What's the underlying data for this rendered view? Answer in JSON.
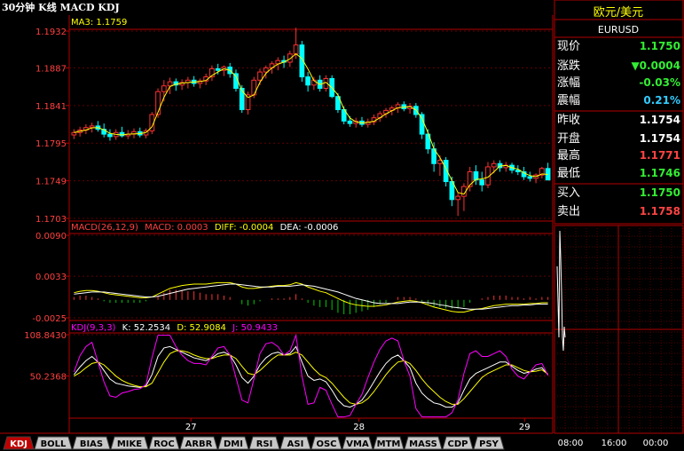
{
  "header": {
    "title": "30分钟 K线 MACD KDJ"
  },
  "price_panel": {
    "ma_label": "MA3: 1.1759",
    "yticks": [
      {
        "label": "1.1932",
        "v": 1.1932
      },
      {
        "label": "1.1887",
        "v": 1.1887
      },
      {
        "label": "1.1841",
        "v": 1.1841
      },
      {
        "label": "1.1795",
        "v": 1.1795
      },
      {
        "label": "1.1749",
        "v": 1.1749
      },
      {
        "label": "1.1703",
        "v": 1.1703
      }
    ],
    "ylim": [
      1.1703,
      1.1932
    ]
  },
  "macd_panel": {
    "label_title": "MACD(26,12,9)",
    "label_macd": "MACD: 0.0003",
    "label_diff": "DIFF: -0.0004",
    "label_dea": "DEA: -0.0006",
    "yticks": [
      {
        "label": "0.0090",
        "v": 0.009
      },
      {
        "label": "0.0033",
        "v": 0.0033
      },
      {
        "label": "-0.0025",
        "v": -0.0025
      }
    ],
    "ylim": [
      -0.0025,
      0.009
    ]
  },
  "kdj_panel": {
    "label_title": "KDJ(9,3,3)",
    "label_k": "K: 52.2534",
    "label_d": "D: 52.9084",
    "label_j": "J: 50.9433",
    "yticks": [
      {
        "label": "108.8430",
        "v": 108.843
      },
      {
        "label": "50.2368",
        "v": 50.2368
      }
    ],
    "ylim": [
      -8.4,
      108.843
    ]
  },
  "xaxis": {
    "labels": [
      {
        "label": "27",
        "pos": 0.25
      },
      {
        "label": "28",
        "pos": 0.6
      },
      {
        "label": "29",
        "pos": 0.945
      }
    ]
  },
  "tabs": [
    "KDJ",
    "BOLL",
    "BIAS",
    "MIKE",
    "ROC",
    "ARBR",
    "DMI",
    "RSI",
    "ASI",
    "OSC",
    "VMA",
    "MTM",
    "MASS",
    "CDP",
    "PSY"
  ],
  "active_tab": "KDJ",
  "quote": {
    "name": "欧元/美元",
    "symbol": "EURUSD",
    "rows": [
      {
        "label": "现价",
        "value": "1.1750",
        "color": "#33ee33"
      },
      {
        "label": "涨跌",
        "value": "▼0.0004",
        "color": "#33ee33"
      },
      {
        "label": "涨幅",
        "value": "-0.03%",
        "color": "#33ee33"
      },
      {
        "label": "震幅",
        "value": "0.21%",
        "color": "#33ccff"
      },
      {
        "label": "昨收",
        "value": "1.1754",
        "color": "#ffffff"
      },
      {
        "label": "开盘",
        "value": "1.1754",
        "color": "#ffffff"
      },
      {
        "label": "最高",
        "value": "1.1771",
        "color": "#ff4444"
      },
      {
        "label": "最低",
        "value": "1.1746",
        "color": "#33ee33"
      },
      {
        "label": "买入",
        "value": "1.1750",
        "color": "#33ee33"
      },
      {
        "label": "卖出",
        "value": "1.1758",
        "color": "#ff4444"
      }
    ]
  },
  "intraday": {
    "time_labels": [
      "08:00",
      "16:00",
      "00:00"
    ]
  },
  "colors": {
    "up": "#ff3030",
    "down": "#00ffff",
    "frame": "#b40000",
    "axis_text": "#ff4040",
    "ma": "#ffff00",
    "k": "#ffffff",
    "d": "#ffff00",
    "j": "#ff00ff"
  },
  "chart_data": [
    {
      "type": "candlestick",
      "title": "MA3: 1.1759",
      "ylim": [
        1.1703,
        1.1932
      ],
      "ohlc": [
        [
          1.1805,
          1.1812,
          1.18,
          1.1808
        ],
        [
          1.1808,
          1.1815,
          1.1803,
          1.1811
        ],
        [
          1.1811,
          1.1818,
          1.1806,
          1.1814
        ],
        [
          1.1814,
          1.182,
          1.1808,
          1.1816
        ],
        [
          1.1816,
          1.1822,
          1.1809,
          1.1812
        ],
        [
          1.1812,
          1.1819,
          1.1802,
          1.1806
        ],
        [
          1.1806,
          1.1812,
          1.1798,
          1.1803
        ],
        [
          1.1803,
          1.1812,
          1.1799,
          1.1808
        ],
        [
          1.1808,
          1.1815,
          1.1802,
          1.1804
        ],
        [
          1.1804,
          1.1811,
          1.18,
          1.1806
        ],
        [
          1.1806,
          1.1813,
          1.1801,
          1.1809
        ],
        [
          1.1809,
          1.1814,
          1.1802,
          1.1805
        ],
        [
          1.1805,
          1.1813,
          1.1801,
          1.181
        ],
        [
          1.181,
          1.1833,
          1.1806,
          1.183
        ],
        [
          1.183,
          1.1862,
          1.1826,
          1.1858
        ],
        [
          1.1858,
          1.1872,
          1.1846,
          1.1865
        ],
        [
          1.1865,
          1.1875,
          1.1855,
          1.187
        ],
        [
          1.187,
          1.1874,
          1.1859,
          1.1866
        ],
        [
          1.1866,
          1.1873,
          1.186,
          1.1869
        ],
        [
          1.1869,
          1.1876,
          1.1862,
          1.1872
        ],
        [
          1.1872,
          1.1877,
          1.1864,
          1.1868
        ],
        [
          1.1868,
          1.1874,
          1.1862,
          1.1871
        ],
        [
          1.1871,
          1.188,
          1.1866,
          1.1876
        ],
        [
          1.1876,
          1.189,
          1.1871,
          1.1886
        ],
        [
          1.1886,
          1.1892,
          1.1879,
          1.1884
        ],
        [
          1.1884,
          1.189,
          1.1877,
          1.1888
        ],
        [
          1.1888,
          1.1893,
          1.1875,
          1.188
        ],
        [
          1.188,
          1.1885,
          1.1858,
          1.1862
        ],
        [
          1.1862,
          1.1866,
          1.1832,
          1.1836
        ],
        [
          1.1836,
          1.1858,
          1.183,
          1.1854
        ],
        [
          1.1854,
          1.1876,
          1.185,
          1.1872
        ],
        [
          1.1872,
          1.1886,
          1.1866,
          1.1882
        ],
        [
          1.1882,
          1.189,
          1.1874,
          1.1887
        ],
        [
          1.1887,
          1.1895,
          1.188,
          1.1892
        ],
        [
          1.1892,
          1.19,
          1.1884,
          1.1896
        ],
        [
          1.1896,
          1.1902,
          1.1887,
          1.1894
        ],
        [
          1.1894,
          1.1908,
          1.1888,
          1.1904
        ],
        [
          1.1904,
          1.1936,
          1.1898,
          1.1915
        ],
        [
          1.1915,
          1.192,
          1.187,
          1.1876
        ],
        [
          1.1876,
          1.1882,
          1.1858,
          1.1866
        ],
        [
          1.1866,
          1.1876,
          1.186,
          1.1872
        ],
        [
          1.1872,
          1.1878,
          1.1858,
          1.1862
        ],
        [
          1.1862,
          1.1878,
          1.1858,
          1.1874
        ],
        [
          1.1874,
          1.1878,
          1.185,
          1.1852
        ],
        [
          1.1852,
          1.1856,
          1.1832,
          1.1836
        ],
        [
          1.1836,
          1.184,
          1.1818,
          1.1822
        ],
        [
          1.1822,
          1.1828,
          1.1815,
          1.1819
        ],
        [
          1.1819,
          1.1826,
          1.1814,
          1.1822
        ],
        [
          1.1822,
          1.1827,
          1.1815,
          1.1818
        ],
        [
          1.1818,
          1.1825,
          1.1814,
          1.1821
        ],
        [
          1.1821,
          1.183,
          1.1817,
          1.1826
        ],
        [
          1.1826,
          1.1834,
          1.1821,
          1.1831
        ],
        [
          1.1831,
          1.1838,
          1.1826,
          1.1835
        ],
        [
          1.1835,
          1.1841,
          1.1829,
          1.1838
        ],
        [
          1.1838,
          1.1845,
          1.1832,
          1.1842
        ],
        [
          1.1842,
          1.1846,
          1.1834,
          1.1837
        ],
        [
          1.1837,
          1.1844,
          1.1831,
          1.184
        ],
        [
          1.184,
          1.1844,
          1.1826,
          1.183
        ],
        [
          1.183,
          1.1833,
          1.18,
          1.1806
        ],
        [
          1.1806,
          1.1812,
          1.1782,
          1.1788
        ],
        [
          1.1788,
          1.1796,
          1.176,
          1.177
        ],
        [
          1.177,
          1.178,
          1.1755,
          1.1774
        ],
        [
          1.1774,
          1.1778,
          1.1742,
          1.1748
        ],
        [
          1.1748,
          1.1754,
          1.1718,
          1.1726
        ],
        [
          1.1726,
          1.1735,
          1.1706,
          1.173
        ],
        [
          1.173,
          1.1746,
          1.1712,
          1.1742
        ],
        [
          1.1742,
          1.1766,
          1.1736,
          1.176
        ],
        [
          1.176,
          1.1768,
          1.1744,
          1.175
        ],
        [
          1.175,
          1.176,
          1.1736,
          1.1744
        ],
        [
          1.1744,
          1.1772,
          1.174,
          1.1766
        ],
        [
          1.1766,
          1.1774,
          1.1758,
          1.177
        ],
        [
          1.177,
          1.1774,
          1.176,
          1.1765
        ],
        [
          1.1765,
          1.1772,
          1.176,
          1.1768
        ],
        [
          1.1768,
          1.1771,
          1.1758,
          1.1762
        ],
        [
          1.1762,
          1.1768,
          1.1756,
          1.176
        ],
        [
          1.176,
          1.1766,
          1.175,
          1.1754
        ],
        [
          1.1754,
          1.176,
          1.1748,
          1.1752
        ],
        [
          1.1752,
          1.1758,
          1.1746,
          1.1756
        ],
        [
          1.1756,
          1.1766,
          1.1752,
          1.1764
        ],
        [
          1.1764,
          1.1771,
          1.1752,
          1.175
        ]
      ]
    },
    {
      "type": "line",
      "title": "MACD(26,12,9)",
      "ylim": [
        -0.0025,
        0.009
      ],
      "series": [
        {
          "name": "DIFF",
          "values": [
            0.001,
            0.0012,
            0.0013,
            0.0013,
            0.0012,
            0.001,
            0.0008,
            0.0007,
            0.0006,
            0.0005,
            0.0004,
            0.0003,
            0.0003,
            0.0004,
            0.0008,
            0.0012,
            0.0016,
            0.0018,
            0.002,
            0.0021,
            0.0022,
            0.0022,
            0.0022,
            0.0023,
            0.0024,
            0.0024,
            0.0024,
            0.0022,
            0.0018,
            0.0016,
            0.0016,
            0.0017,
            0.0018,
            0.0019,
            0.002,
            0.002,
            0.0021,
            0.0024,
            0.0022,
            0.0018,
            0.0015,
            0.0012,
            0.001,
            0.0006,
            0.0002,
            -0.0002,
            -0.0005,
            -0.0007,
            -0.0008,
            -0.0009,
            -0.0009,
            -0.0008,
            -0.0007,
            -0.0005,
            -0.0003,
            -0.0002,
            -0.0001,
            -0.0002,
            -0.0004,
            -0.0007,
            -0.001,
            -0.0012,
            -0.0014,
            -0.0016,
            -0.0017,
            -0.0017,
            -0.0015,
            -0.0013,
            -0.0012,
            -0.001,
            -0.0008,
            -0.0007,
            -0.0006,
            -0.0006,
            -0.0006,
            -0.0006,
            -0.0005,
            -0.0005,
            -0.0004,
            -0.0004
          ]
        },
        {
          "name": "DEA",
          "values": [
            0.0008,
            0.0009,
            0.001,
            0.0011,
            0.0011,
            0.0011,
            0.001,
            0.0009,
            0.0008,
            0.0007,
            0.0006,
            0.0005,
            0.0004,
            0.0004,
            0.0005,
            0.0007,
            0.0009,
            0.0011,
            0.0013,
            0.0015,
            0.0016,
            0.0017,
            0.0018,
            0.0019,
            0.002,
            0.0021,
            0.0022,
            0.0022,
            0.0021,
            0.002,
            0.0019,
            0.0018,
            0.0018,
            0.0018,
            0.0019,
            0.0019,
            0.0019,
            0.002,
            0.0021,
            0.002,
            0.0019,
            0.0017,
            0.0015,
            0.0013,
            0.0011,
            0.0008,
            0.0005,
            0.0002,
            0.0,
            -0.0002,
            -0.0004,
            -0.0005,
            -0.0005,
            -0.0005,
            -0.0005,
            -0.0004,
            -0.0003,
            -0.0003,
            -0.0003,
            -0.0004,
            -0.0005,
            -0.0007,
            -0.0008,
            -0.001,
            -0.0011,
            -0.0012,
            -0.0013,
            -0.0013,
            -0.0013,
            -0.0012,
            -0.0011,
            -0.001,
            -0.0009,
            -0.0008,
            -0.0008,
            -0.0007,
            -0.0007,
            -0.0006,
            -0.0006,
            -0.0006
          ]
        }
      ]
    },
    {
      "type": "line",
      "title": "KDJ(9,3,3)",
      "ylim": [
        -8.4,
        108.843
      ],
      "series": [
        {
          "name": "K",
          "values": [
            52,
            63,
            72,
            78,
            70,
            58,
            46,
            40,
            38,
            36,
            35,
            34,
            36,
            52,
            78,
            90,
            92,
            88,
            84,
            80,
            76,
            74,
            72,
            76,
            82,
            84,
            80,
            66,
            48,
            40,
            50,
            66,
            76,
            82,
            84,
            80,
            82,
            92,
            70,
            50,
            44,
            46,
            42,
            30,
            16,
            8,
            6,
            10,
            16,
            28,
            42,
            56,
            68,
            76,
            80,
            72,
            62,
            40,
            26,
            18,
            12,
            10,
            6,
            6,
            12,
            30,
            46,
            54,
            58,
            62,
            66,
            70,
            70,
            64,
            58,
            54,
            56,
            60,
            62,
            52
          ]
        },
        {
          "name": "D",
          "values": [
            50,
            55,
            62,
            68,
            70,
            66,
            58,
            50,
            44,
            40,
            37,
            35,
            35,
            40,
            55,
            70,
            82,
            86,
            86,
            84,
            80,
            77,
            75,
            75,
            78,
            80,
            80,
            75,
            64,
            54,
            52,
            58,
            66,
            74,
            80,
            80,
            80,
            84,
            80,
            70,
            60,
            52,
            48,
            40,
            30,
            20,
            12,
            10,
            12,
            18,
            28,
            40,
            52,
            62,
            70,
            72,
            68,
            58,
            46,
            36,
            28,
            20,
            14,
            10,
            10,
            18,
            28,
            38,
            48,
            54,
            58,
            62,
            66,
            66,
            62,
            58,
            56,
            57,
            59,
            53
          ]
        },
        {
          "name": "J",
          "values": [
            56,
            79,
            92,
            98,
            70,
            42,
            22,
            20,
            26,
            28,
            31,
            32,
            38,
            76,
            108,
            108,
            108,
            92,
            80,
            72,
            68,
            68,
            66,
            78,
            90,
            92,
            80,
            48,
            16,
            12,
            46,
            82,
            96,
            98,
            92,
            80,
            86,
            108,
            50,
            10,
            12,
            34,
            30,
            10,
            -8,
            -8,
            -6,
            10,
            24,
            48,
            70,
            88,
            100,
            104,
            100,
            72,
            50,
            4,
            -8,
            -8,
            -8,
            -8,
            -8,
            -2,
            16,
            54,
            82,
            86,
            78,
            78,
            82,
            86,
            78,
            60,
            50,
            46,
            56,
            66,
            68,
            51
          ]
        }
      ]
    }
  ]
}
